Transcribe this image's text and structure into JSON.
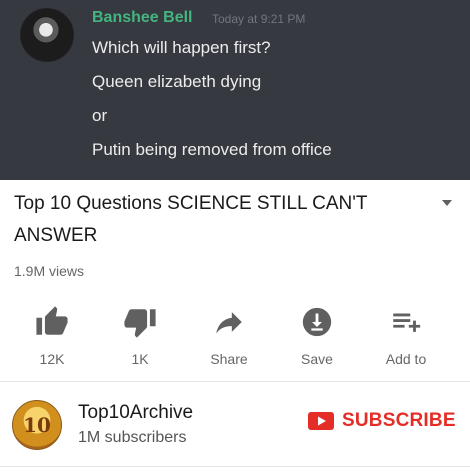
{
  "chat": {
    "username": "Banshee Bell",
    "timestamp": "Today at 9:21 PM",
    "messages": [
      "Which will happen first?",
      "Queen elizabeth dying",
      "or",
      "Putin being removed from office"
    ]
  },
  "video": {
    "title": "Top 10 Questions SCIENCE STILL CAN'T ANSWER",
    "views": "1.9M views",
    "actions": {
      "like": {
        "icon": "thumbs-up-icon",
        "label": "12K"
      },
      "dislike": {
        "icon": "thumbs-down-icon",
        "label": "1K"
      },
      "share": {
        "icon": "share-arrow-icon",
        "label": "Share"
      },
      "save": {
        "icon": "download-icon",
        "label": "Save"
      },
      "add_to": {
        "icon": "playlist-add-icon",
        "label": "Add to"
      }
    }
  },
  "channel": {
    "name": "Top10Archive",
    "subscribers": "1M subscribers",
    "avatar_text": "10",
    "subscribe_label": "SUBSCRIBE"
  },
  "colors": {
    "chat_background": "#36393f",
    "username": "#43b581",
    "subscribe_red": "#e52d27",
    "icon_gray": "#666666"
  }
}
